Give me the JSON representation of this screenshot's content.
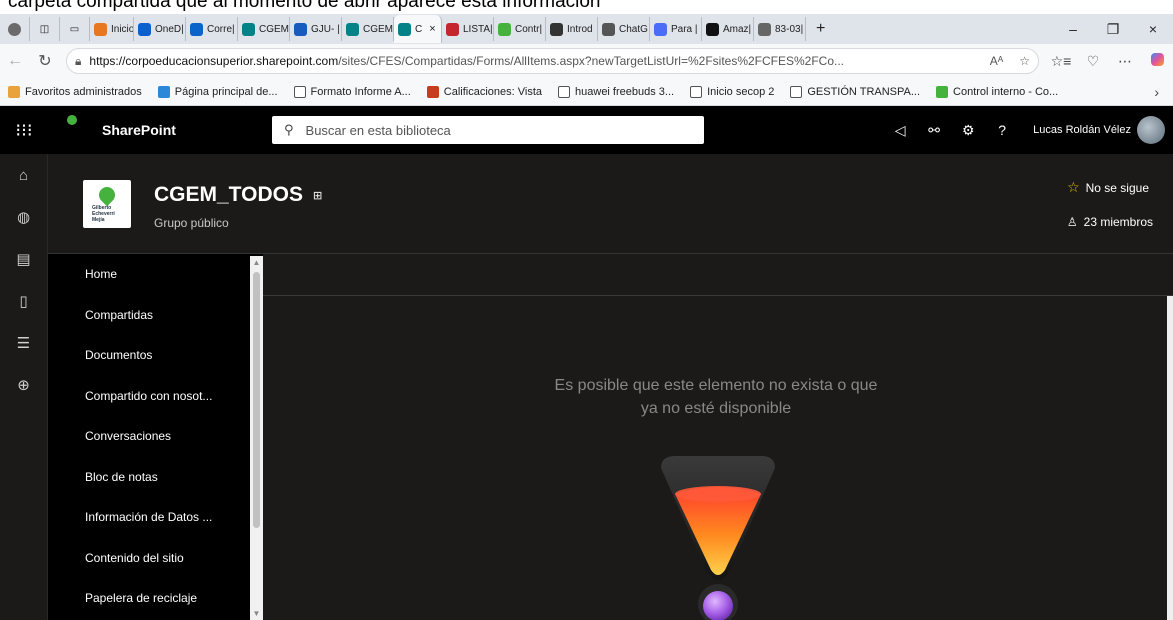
{
  "caption": "carpeta compartida que al momento de abrir aparece esta información",
  "browser": {
    "tabs": [
      {
        "label": "Inicio |",
        "color": "#e87722"
      },
      {
        "label": "OneD|",
        "color": "#0a5fd1"
      },
      {
        "label": "Corre|",
        "color": "#0a64c9"
      },
      {
        "label": "CGEM",
        "color": "#038387"
      },
      {
        "label": "GJU- |",
        "color": "#185abd"
      },
      {
        "label": "CGEM",
        "color": "#038387"
      },
      {
        "label": "C",
        "color": "#038387"
      },
      {
        "label": "LISTA|",
        "color": "#c4262e"
      },
      {
        "label": "Contr|",
        "color": "#45b23e"
      },
      {
        "label": "Introd",
        "color": "#333333"
      },
      {
        "label": "ChatG",
        "color": "#555555"
      },
      {
        "label": "Para |",
        "color": "#4a6cf7"
      },
      {
        "label": "Amaz|",
        "color": "#111111"
      },
      {
        "label": "83-03|",
        "color": "#666666"
      }
    ],
    "active_close": "×",
    "new_tab": "+",
    "window_controls": [
      "–",
      "❐",
      "×"
    ],
    "url_host": "https://corpoeducacionsuperior.sharepoint.com",
    "url_path": "/sites/CFES/Compartidas/Forms/AllItems.aspx?newTargetListUrl=%2Fsites%2FCFES%2FCo...",
    "url_read_aloud": "Aᴬ",
    "favorites": [
      {
        "label": "Favoritos administrados",
        "color": "#e8a33d"
      },
      {
        "label": "Página principal de...",
        "color": "#2b88d8"
      },
      {
        "label": "Formato Informe A...",
        "color": ""
      },
      {
        "label": "Calificaciones: Vista",
        "color": "#c43e1c"
      },
      {
        "label": "huawei freebuds 3...",
        "color": ""
      },
      {
        "label": "Inicio secop 2",
        "color": ""
      },
      {
        "label": "GESTIÓN TRANSPA...",
        "color": ""
      },
      {
        "label": "Control interno - Co...",
        "color": "#45b23e"
      }
    ]
  },
  "sharepoint": {
    "app_name": "SharePoint",
    "search_placeholder": "Buscar en esta biblioteca",
    "user_name": "Lucas Roldán Vélez",
    "logo_text": "Gilberto Echeverri Mejía",
    "site": {
      "title": "CGEM_TODOS",
      "subtitle": "Grupo público",
      "follow_label": "No se sigue",
      "members_label": "23 miembros",
      "logo_lines": [
        "Gilberto",
        "Echeverri",
        "Mejía"
      ]
    },
    "nav": [
      "Home",
      "Compartidas",
      "Documentos",
      "Compartido con nosot...",
      "Conversaciones",
      "Bloc de notas",
      "Información de Datos ...",
      "Contenido del sitio",
      "Papelera de reciclaje"
    ],
    "message": "Es posible que este elemento no exista o que ya no esté disponible"
  }
}
